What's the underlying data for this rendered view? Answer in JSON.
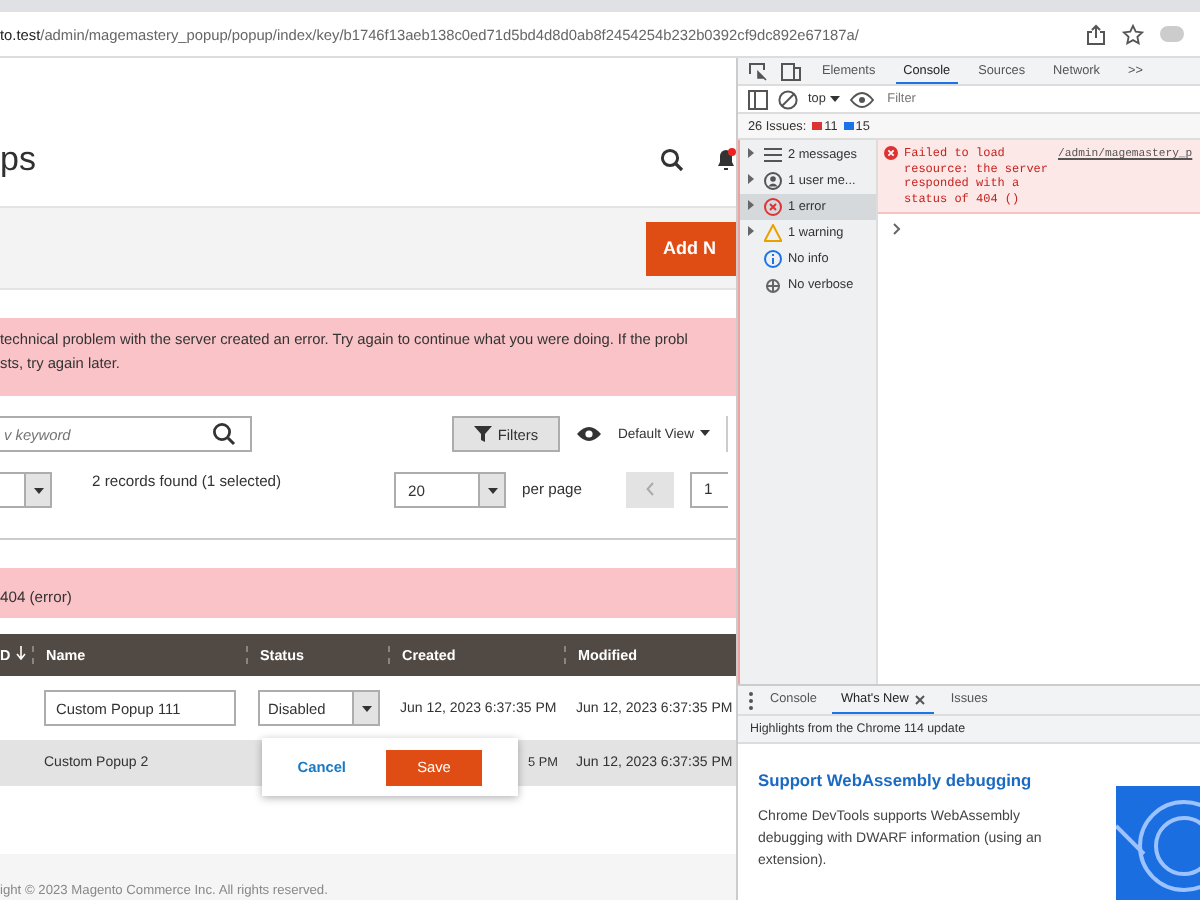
{
  "browser": {
    "url_host": "to.test",
    "url_path": "/admin/magemastery_popup/popup/index/key/b1746f13aeb138c0ed71d5bd4d8d0ab8f2454254b232b0392cf9dc892e67187a/"
  },
  "admin": {
    "title": "ps",
    "add_button": "Add N",
    "error_message": "technical problem with the server created an error. Try again to continue what you were doing. If the probl\nsts, try again later.",
    "search": {
      "placeholder": "v keyword"
    },
    "filters_button": "Filters",
    "view_button": "Default View",
    "records": "2 records found (1 selected)",
    "per_page_value": "20",
    "per_page_label": "per page",
    "page": "1",
    "error_404": "404 (error)",
    "columns": [
      {
        "label": "D",
        "sorted": true
      },
      {
        "label": "Name",
        "sorted": false
      },
      {
        "label": "Status",
        "sorted": false
      },
      {
        "label": "Created",
        "sorted": false
      },
      {
        "label": "Modified",
        "sorted": false
      }
    ],
    "rows": [
      {
        "editing": true,
        "name": "Custom Popup 111",
        "status": "Disabled",
        "created": "Jun 12, 2023 6:37:35 PM",
        "modified": "Jun 12, 2023 6:37:35 PM"
      },
      {
        "editing": false,
        "name": "Custom Popup 2",
        "status": "",
        "created": "5 PM",
        "modified": "Jun 12, 2023 6:37:35 PM"
      }
    ],
    "cancel_button": "Cancel",
    "save_button": "Save",
    "footer": "ight © 2023 Magento Commerce Inc. All rights reserved."
  },
  "devtools": {
    "tabs": [
      {
        "label": "Elements",
        "selected": false
      },
      {
        "label": "Console",
        "selected": true
      },
      {
        "label": "Sources",
        "selected": false
      },
      {
        "label": "Network",
        "selected": false
      }
    ],
    "more_tabs": ">>",
    "context": "top",
    "filter": {
      "placeholder": "Filter"
    },
    "issues": {
      "label": "26 Issues:",
      "errors": "11",
      "infos": "15"
    },
    "sidebar": [
      {
        "kind": "messages",
        "label": "2 messages",
        "expandable": true,
        "selected": false
      },
      {
        "kind": "user",
        "label": "1 user me...",
        "expandable": true,
        "selected": false
      },
      {
        "kind": "error",
        "label": "1 error",
        "expandable": true,
        "selected": true
      },
      {
        "kind": "warning",
        "label": "1 warning",
        "expandable": true,
        "selected": false
      },
      {
        "kind": "info",
        "label": "No info",
        "expandable": false,
        "selected": false
      },
      {
        "kind": "verbose",
        "label": "No verbose",
        "expandable": false,
        "selected": false
      }
    ],
    "error_message": "Failed to load resource: the server responded with a status of 404 ()",
    "error_source": "/admin/magemastery_p",
    "drawer_tabs": [
      {
        "label": "Console",
        "selected": false,
        "closable": false
      },
      {
        "label": "What's New",
        "selected": true,
        "closable": true
      },
      {
        "label": "Issues",
        "selected": false,
        "closable": false
      }
    ],
    "highlights": "Highlights from the Chrome 114 update",
    "article": {
      "title": "Support WebAssembly debugging",
      "body": "Chrome DevTools supports WebAssembly debugging with DWARF information (using an extension)."
    }
  }
}
